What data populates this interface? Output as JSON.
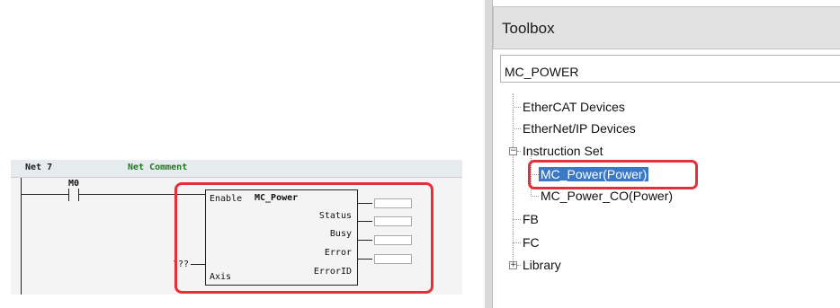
{
  "ladder": {
    "net_label": "Net 7",
    "net_comment": "Net Comment",
    "contact_label": "M0",
    "fb_enable": "Enable",
    "fb_name": "MC_Power",
    "fb_outputs": [
      "Status",
      "Busy",
      "Error",
      "ErrorID"
    ],
    "fb_input_axis": "Axis",
    "axis_variable": "???"
  },
  "toolbox": {
    "title": "Toolbox",
    "search_value": "MC_POWER",
    "tree": {
      "ethercat_devices": "EtherCAT Devices",
      "ethernet_ip_devices": "EtherNet/IP Devices",
      "instruction_set": "Instruction Set",
      "mc_power": "MC_Power(Power)",
      "mc_power_co": "MC_Power_CO(Power)",
      "fb": "FB",
      "fc": "FC",
      "library": "Library"
    },
    "selected_item": "MC_Power(Power)"
  },
  "colors": {
    "highlight_red": "#e5303a",
    "selection_blue": "#3b79c7",
    "net_comment_green": "#1f7a1f"
  }
}
